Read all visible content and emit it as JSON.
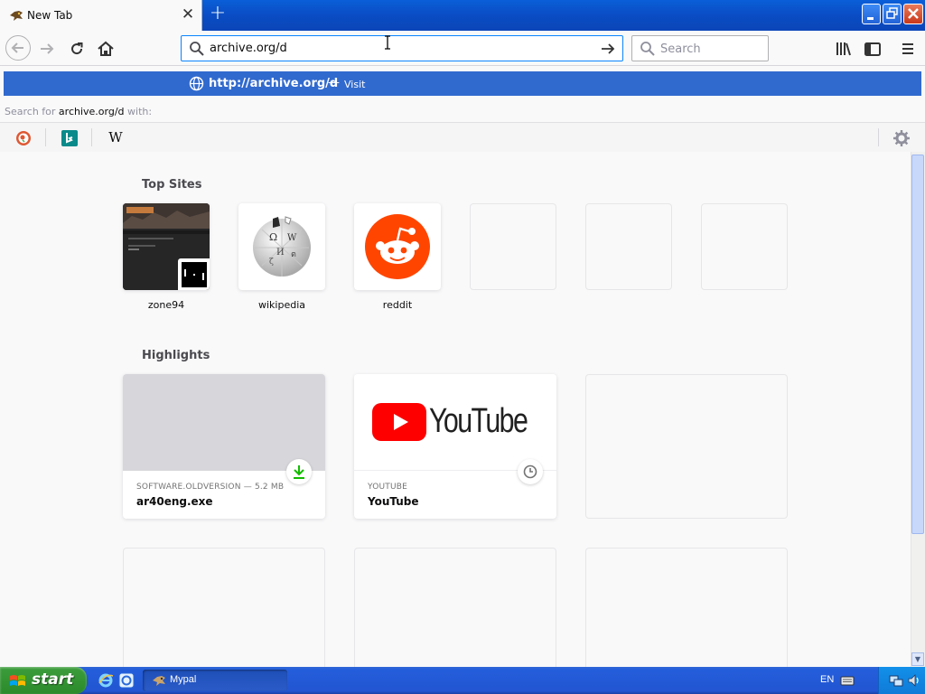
{
  "tab": {
    "title": "New Tab",
    "close": "✕"
  },
  "navbar": {
    "url_value": "archive.org/d",
    "search_placeholder": "Search"
  },
  "popup": {
    "heuristic_url": "http://archive.org/d",
    "heuristic_dash": "—",
    "heuristic_action": "Visit",
    "search_for_prefix": "Search for",
    "search_for_term": "archive.org/d",
    "search_for_suffix": "with:"
  },
  "top_sites": {
    "title": "Top Sites",
    "tiles": [
      {
        "label": "zone94"
      },
      {
        "label": "wikipedia"
      },
      {
        "label": "reddit"
      }
    ]
  },
  "highlights": {
    "title": "Highlights",
    "cards": [
      {
        "context": "SOFTWARE.OLDVERSION — 5.2 MB",
        "title": "ar40eng.exe"
      },
      {
        "context": "YOUTUBE",
        "title": "YouTube",
        "brand": "YouTube"
      }
    ]
  },
  "taskbar": {
    "start": "start",
    "window": "Mypal",
    "lang": "EN"
  },
  "colors": {
    "accent": "#0a84ff",
    "heuristic_bg": "#316ace",
    "reddit": "#ff4500",
    "youtube_red": "#ff0000"
  }
}
